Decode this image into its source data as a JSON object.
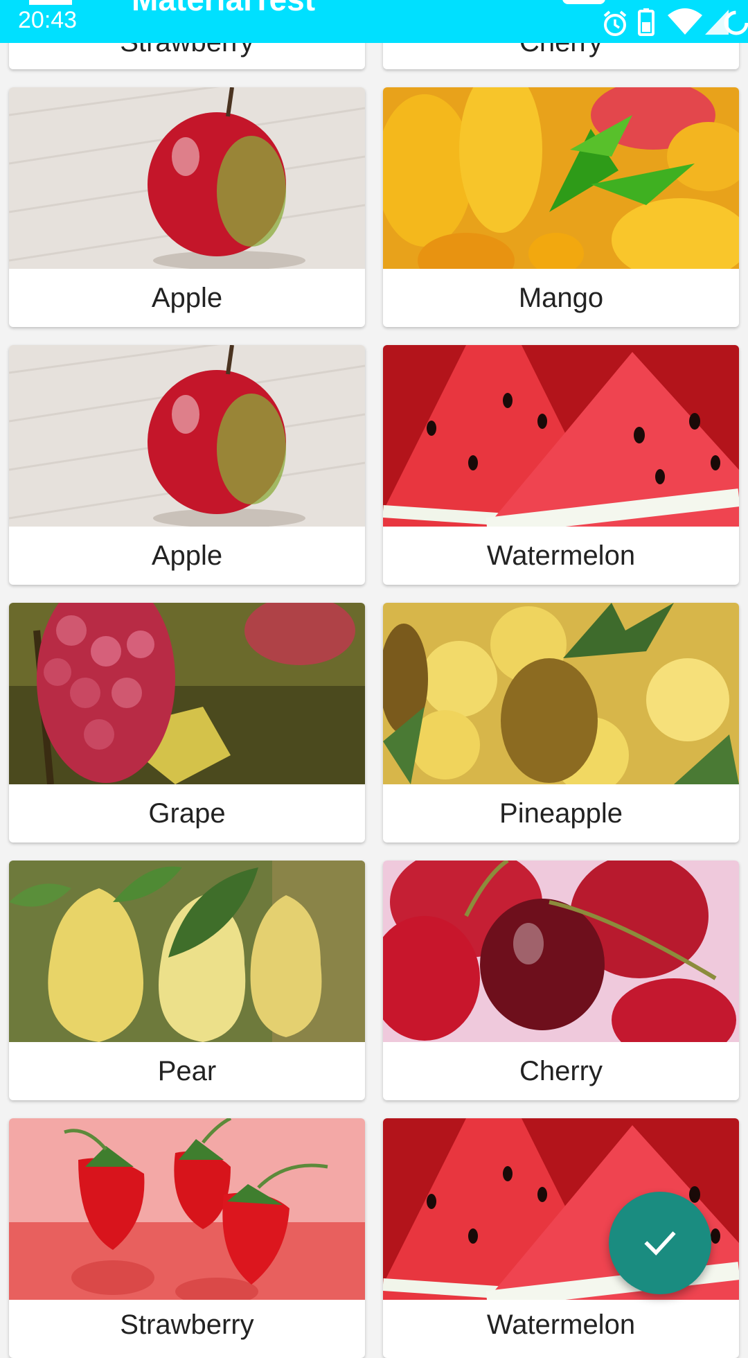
{
  "status_bar": {
    "time": "20:43",
    "icons": [
      "alarm-icon",
      "battery-icon",
      "wifi-icon",
      "signal-icon",
      "sync-icon"
    ],
    "background": "#00e0ff"
  },
  "toolbar": {
    "title": "MaterialTest",
    "menu_icon": "menu-icon"
  },
  "cards": [
    {
      "name": "Strawberry"
    },
    {
      "name": "Cherry"
    },
    {
      "name": "Apple"
    },
    {
      "name": "Mango"
    },
    {
      "name": "Apple"
    },
    {
      "name": "Watermelon"
    },
    {
      "name": "Grape"
    },
    {
      "name": "Pineapple"
    },
    {
      "name": "Pear"
    },
    {
      "name": "Cherry"
    },
    {
      "name": "Strawberry"
    },
    {
      "name": "Watermelon"
    }
  ],
  "fab": {
    "icon": "check-icon",
    "color": "#1a8c80"
  }
}
